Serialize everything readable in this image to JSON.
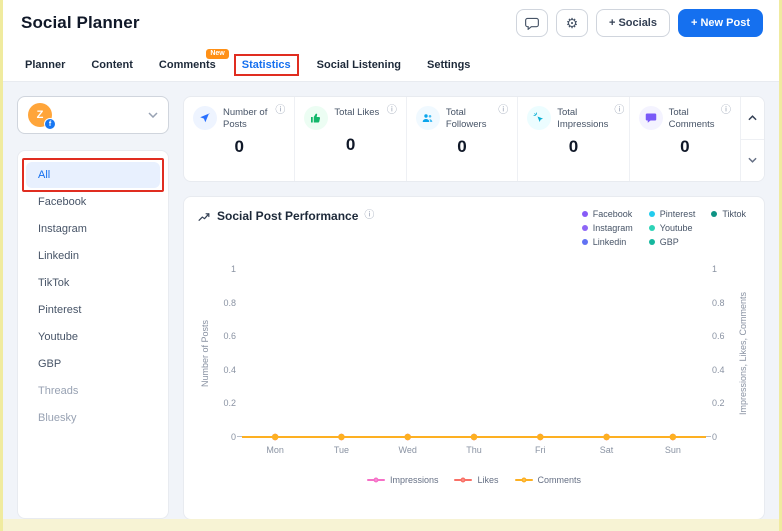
{
  "page": {
    "bg": "#f1f4f9",
    "accent": "#1570ef",
    "annotation_color": "#e02d20",
    "frame_color": "#f0eb9f",
    "bottom_strip_color": "#f7f3d4"
  },
  "header": {
    "title": "Social Planner",
    "feedback_icon": "comment-icon",
    "settings_icon": "gear-icon",
    "socials_button": "+ Socials",
    "new_post_button": "+ New Post"
  },
  "tabs": [
    {
      "label": "Planner"
    },
    {
      "label": "Content"
    },
    {
      "label": "Comments",
      "badge": "New"
    },
    {
      "label": "Statistics",
      "active": true,
      "annotated": true
    },
    {
      "label": "Social Listening"
    },
    {
      "label": "Settings"
    }
  ],
  "sidebar": {
    "account": {
      "initial": "Z",
      "network_badge": "f",
      "avatar_color": "#ffa53a"
    },
    "items": [
      {
        "label": "All",
        "active": true,
        "annotated": true
      },
      {
        "label": "Facebook"
      },
      {
        "label": "Instagram"
      },
      {
        "label": "Linkedin"
      },
      {
        "label": "TikTok"
      },
      {
        "label": "Pinterest"
      },
      {
        "label": "Youtube"
      },
      {
        "label": "GBP"
      },
      {
        "label": "Threads",
        "disabled": true
      },
      {
        "label": "Bluesky",
        "disabled": true
      }
    ]
  },
  "stats": [
    {
      "label": "Number of Posts",
      "value": "0",
      "icon": "paper-plane-icon",
      "color": "#2970ff",
      "tint": "#eef4ff"
    },
    {
      "label": "Total Likes",
      "value": "0",
      "icon": "thumbs-up-icon",
      "color": "#12b76a",
      "tint": "#ecfdf3"
    },
    {
      "label": "Total Followers",
      "value": "0",
      "icon": "users-icon",
      "color": "#0ba5ec",
      "tint": "#f0f9ff"
    },
    {
      "label": "Total Impressions",
      "value": "0",
      "icon": "cursor-click-icon",
      "color": "#06aed4",
      "tint": "#ecfdff"
    },
    {
      "label": "Total Comments",
      "value": "0",
      "icon": "chat-bubble-icon",
      "color": "#7a5af8",
      "tint": "#f4f3ff"
    }
  ],
  "info_glyph": "ⓘ",
  "chart_data": {
    "type": "line",
    "title": "Social Post Performance",
    "x": [
      "Mon",
      "Tue",
      "Wed",
      "Thu",
      "Fri",
      "Sat",
      "Sun"
    ],
    "series": [
      {
        "name": "Impressions",
        "color": "#f670c7",
        "values": [
          0,
          0,
          0,
          0,
          0,
          0,
          0
        ]
      },
      {
        "name": "Likes",
        "color": "#f97066",
        "values": [
          0,
          0,
          0,
          0,
          0,
          0,
          0
        ]
      },
      {
        "name": "Comments",
        "color": "#fdb022",
        "values": [
          0,
          0,
          0,
          0,
          0,
          0,
          0
        ]
      }
    ],
    "networks_legend": [
      {
        "name": "Facebook",
        "color": "#875bf7"
      },
      {
        "name": "Instagram",
        "color": "#8e66f6"
      },
      {
        "name": "Linkedin",
        "color": "#6172f3"
      },
      {
        "name": "Pinterest",
        "color": "#22ccee"
      },
      {
        "name": "Youtube",
        "color": "#2ed3b7"
      },
      {
        "name": "GBP",
        "color": "#15b79e"
      },
      {
        "name": "Tiktok",
        "color": "#0e9384"
      }
    ],
    "ylabel_left": "Number of Posts",
    "ylabel_right": "Impressions, Likes, Comments",
    "ylim": [
      0,
      1
    ],
    "yticks": [
      "0",
      "0.2",
      "0.4",
      "0.6",
      "0.8",
      "1"
    ],
    "legend_position": "top-right",
    "grid": false
  }
}
